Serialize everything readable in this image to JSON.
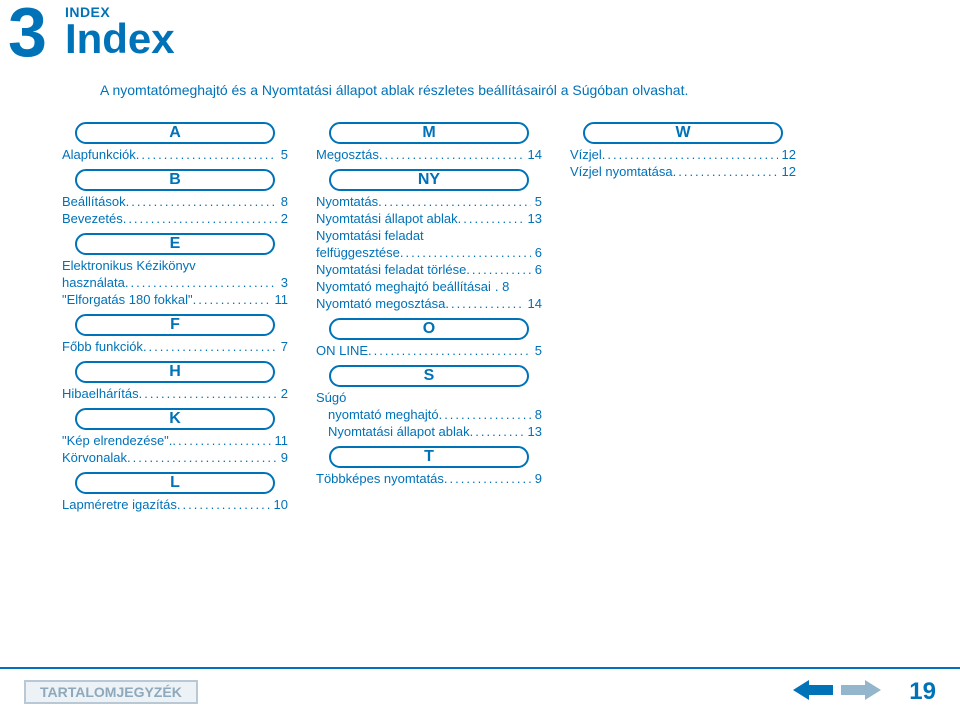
{
  "section_label": "INDEX",
  "title": "Index",
  "chapter_number": "3",
  "intro_text": "A nyomtatómeghajtó és a Nyomtatási állapot ablak részletes beállításairól a Súgóban olvashat.",
  "toc_button": "TARTALOMJEGYZÉK",
  "page_number": "19",
  "cols": [
    [
      {
        "type": "head",
        "text": "A"
      },
      {
        "type": "entry",
        "label": "Alapfunkciók",
        "page": "5"
      },
      {
        "type": "head",
        "text": "B"
      },
      {
        "type": "entry",
        "label": "Beállítások",
        "page": "8"
      },
      {
        "type": "entry",
        "label": "Bevezetés",
        "page": "2"
      },
      {
        "type": "head",
        "text": "E"
      },
      {
        "type": "entry",
        "label": "Elektronikus Kézikönyv",
        "nopage": true
      },
      {
        "type": "entry",
        "label": "használata",
        "page": "3"
      },
      {
        "type": "entry",
        "label": "\"Elforgatás 180 fokkal\"",
        "page": "11"
      },
      {
        "type": "head",
        "text": "F"
      },
      {
        "type": "entry",
        "label": "Főbb funkciók",
        "page": "7"
      },
      {
        "type": "head",
        "text": "H"
      },
      {
        "type": "entry",
        "label": "Hibaelhárítás",
        "page": "2"
      },
      {
        "type": "head",
        "text": "K"
      },
      {
        "type": "entry",
        "label": "\"Kép elrendezése\".",
        "page": "11"
      },
      {
        "type": "entry",
        "label": "Körvonalak",
        "page": "9"
      },
      {
        "type": "head",
        "text": "L"
      },
      {
        "type": "entry",
        "label": "Lapméretre igazítás",
        "page": "10"
      }
    ],
    [
      {
        "type": "head",
        "text": "M"
      },
      {
        "type": "entry",
        "label": "Megosztás",
        "page": "14"
      },
      {
        "type": "head",
        "text": "NY"
      },
      {
        "type": "entry",
        "label": "Nyomtatás",
        "page": "5"
      },
      {
        "type": "entry",
        "label": "Nyomtatási állapot ablak",
        "page": "13"
      },
      {
        "type": "entry",
        "label": "Nyomtatási feladat",
        "nopage": true
      },
      {
        "type": "entry",
        "label": "felfüggesztése",
        "page": "6"
      },
      {
        "type": "entry",
        "label": "Nyomtatási feladat törlése",
        "page": "6"
      },
      {
        "type": "entry",
        "label": "Nyomtató meghajtó beállításai",
        "page": ". 8",
        "raw": true
      },
      {
        "type": "entry",
        "label": "Nyomtató megosztása",
        "page": "14"
      },
      {
        "type": "head",
        "text": "O"
      },
      {
        "type": "entry",
        "label": "ON LINE",
        "page": "5"
      },
      {
        "type": "head",
        "text": "S"
      },
      {
        "type": "entry",
        "label": "Súgó",
        "nopage": true
      },
      {
        "type": "entry",
        "label": "nyomtató meghajtó",
        "page": "8",
        "sub": true
      },
      {
        "type": "entry",
        "label": "Nyomtatási állapot ablak",
        "page": "13",
        "sub": true
      },
      {
        "type": "head",
        "text": "T"
      },
      {
        "type": "entry",
        "label": "Többképes nyomtatás",
        "page": "9"
      }
    ],
    [
      {
        "type": "head",
        "text": "W"
      },
      {
        "type": "entry",
        "label": "Vízjel",
        "page": "12"
      },
      {
        "type": "entry",
        "label": "Vízjel nyomtatása",
        "page": "12"
      }
    ]
  ]
}
